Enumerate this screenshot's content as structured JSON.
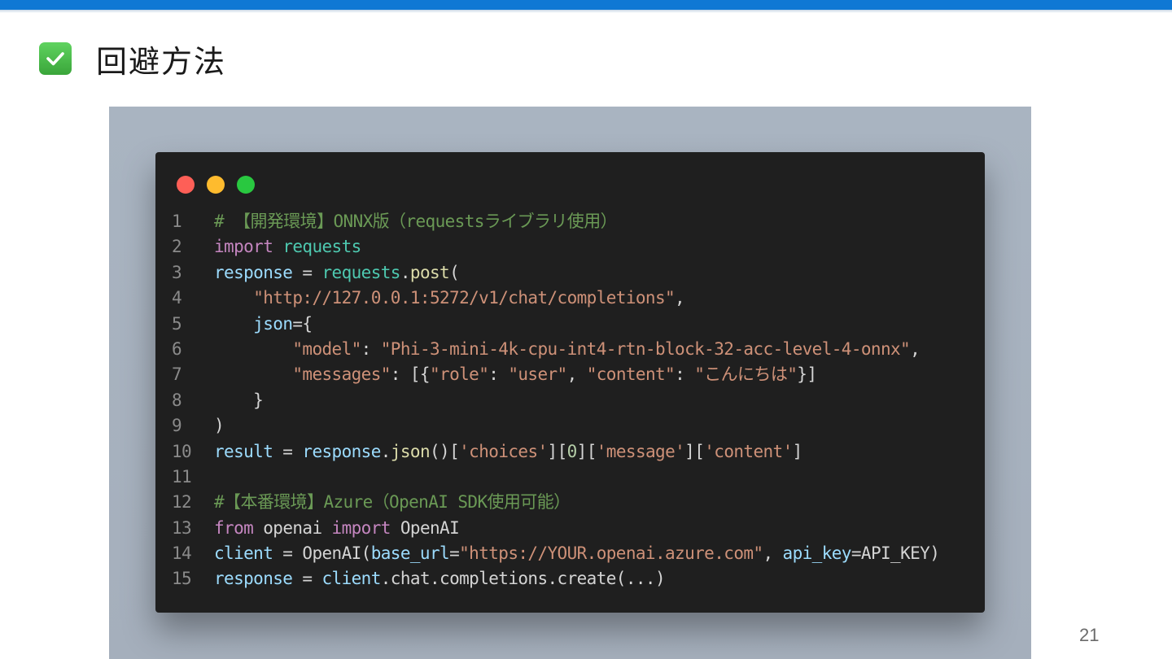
{
  "slide": {
    "title": "回避方法",
    "page_number": "21",
    "accent_color": "#0f78d4",
    "title_icon": "check-mark-icon"
  },
  "window_controls": [
    "close-dot",
    "minimize-dot",
    "maximize-dot"
  ],
  "code_lines": [
    {
      "n": "1",
      "tokens": [
        {
          "t": "# 【開発環境】ONNX版（requestsライブラリ使用）",
          "c": "comment"
        }
      ]
    },
    {
      "n": "2",
      "tokens": [
        {
          "t": "import",
          "c": "kw"
        },
        {
          "t": " ",
          "c": "plain"
        },
        {
          "t": "requests",
          "c": "mod"
        }
      ]
    },
    {
      "n": "3",
      "tokens": [
        {
          "t": "response",
          "c": "var"
        },
        {
          "t": " = ",
          "c": "plain"
        },
        {
          "t": "requests",
          "c": "mod"
        },
        {
          "t": ".",
          "c": "plain"
        },
        {
          "t": "post",
          "c": "fn"
        },
        {
          "t": "(",
          "c": "plain"
        }
      ]
    },
    {
      "n": "4",
      "tokens": [
        {
          "t": "    ",
          "c": "plain"
        },
        {
          "t": "\"http://127.0.0.1:5272/v1/chat/completions\"",
          "c": "str"
        },
        {
          "t": ",",
          "c": "plain"
        }
      ]
    },
    {
      "n": "5",
      "tokens": [
        {
          "t": "    ",
          "c": "plain"
        },
        {
          "t": "json",
          "c": "var"
        },
        {
          "t": "={",
          "c": "plain"
        }
      ]
    },
    {
      "n": "6",
      "tokens": [
        {
          "t": "        ",
          "c": "plain"
        },
        {
          "t": "\"model\"",
          "c": "str"
        },
        {
          "t": ": ",
          "c": "plain"
        },
        {
          "t": "\"Phi-3-mini-4k-cpu-int4-rtn-block-32-acc-level-4-onnx\"",
          "c": "str"
        },
        {
          "t": ",",
          "c": "plain"
        }
      ]
    },
    {
      "n": "7",
      "tokens": [
        {
          "t": "        ",
          "c": "plain"
        },
        {
          "t": "\"messages\"",
          "c": "str"
        },
        {
          "t": ": [{",
          "c": "plain"
        },
        {
          "t": "\"role\"",
          "c": "str"
        },
        {
          "t": ": ",
          "c": "plain"
        },
        {
          "t": "\"user\"",
          "c": "str"
        },
        {
          "t": ", ",
          "c": "plain"
        },
        {
          "t": "\"content\"",
          "c": "str"
        },
        {
          "t": ": ",
          "c": "plain"
        },
        {
          "t": "\"こんにちは\"",
          "c": "str"
        },
        {
          "t": "}]",
          "c": "plain"
        }
      ]
    },
    {
      "n": "8",
      "tokens": [
        {
          "t": "    }",
          "c": "plain"
        }
      ]
    },
    {
      "n": "9",
      "tokens": [
        {
          "t": ")",
          "c": "plain"
        }
      ]
    },
    {
      "n": "10",
      "tokens": [
        {
          "t": "result",
          "c": "var"
        },
        {
          "t": " = ",
          "c": "plain"
        },
        {
          "t": "response",
          "c": "var"
        },
        {
          "t": ".",
          "c": "plain"
        },
        {
          "t": "json",
          "c": "fn"
        },
        {
          "t": "()[",
          "c": "plain"
        },
        {
          "t": "'choices'",
          "c": "str"
        },
        {
          "t": "][",
          "c": "plain"
        },
        {
          "t": "0",
          "c": "num"
        },
        {
          "t": "][",
          "c": "plain"
        },
        {
          "t": "'message'",
          "c": "str"
        },
        {
          "t": "][",
          "c": "plain"
        },
        {
          "t": "'content'",
          "c": "str"
        },
        {
          "t": "]",
          "c": "plain"
        }
      ]
    },
    {
      "n": "11",
      "tokens": []
    },
    {
      "n": "12",
      "tokens": [
        {
          "t": "#【本番環境】Azure（OpenAI SDK使用可能）",
          "c": "comment"
        }
      ]
    },
    {
      "n": "13",
      "tokens": [
        {
          "t": "from",
          "c": "kw"
        },
        {
          "t": " openai ",
          "c": "plain"
        },
        {
          "t": "import",
          "c": "kw"
        },
        {
          "t": " OpenAI",
          "c": "plain"
        }
      ]
    },
    {
      "n": "14",
      "tokens": [
        {
          "t": "client",
          "c": "var"
        },
        {
          "t": " = OpenAI(",
          "c": "plain"
        },
        {
          "t": "base_url",
          "c": "var"
        },
        {
          "t": "=",
          "c": "plain"
        },
        {
          "t": "\"https://YOUR.openai.azure.com\"",
          "c": "str"
        },
        {
          "t": ", ",
          "c": "plain"
        },
        {
          "t": "api_key",
          "c": "var"
        },
        {
          "t": "=API_KEY)",
          "c": "plain"
        }
      ]
    },
    {
      "n": "15",
      "tokens": [
        {
          "t": "response",
          "c": "var"
        },
        {
          "t": " = ",
          "c": "plain"
        },
        {
          "t": "client",
          "c": "var"
        },
        {
          "t": ".chat.completions.create(...)",
          "c": "plain"
        }
      ]
    }
  ]
}
